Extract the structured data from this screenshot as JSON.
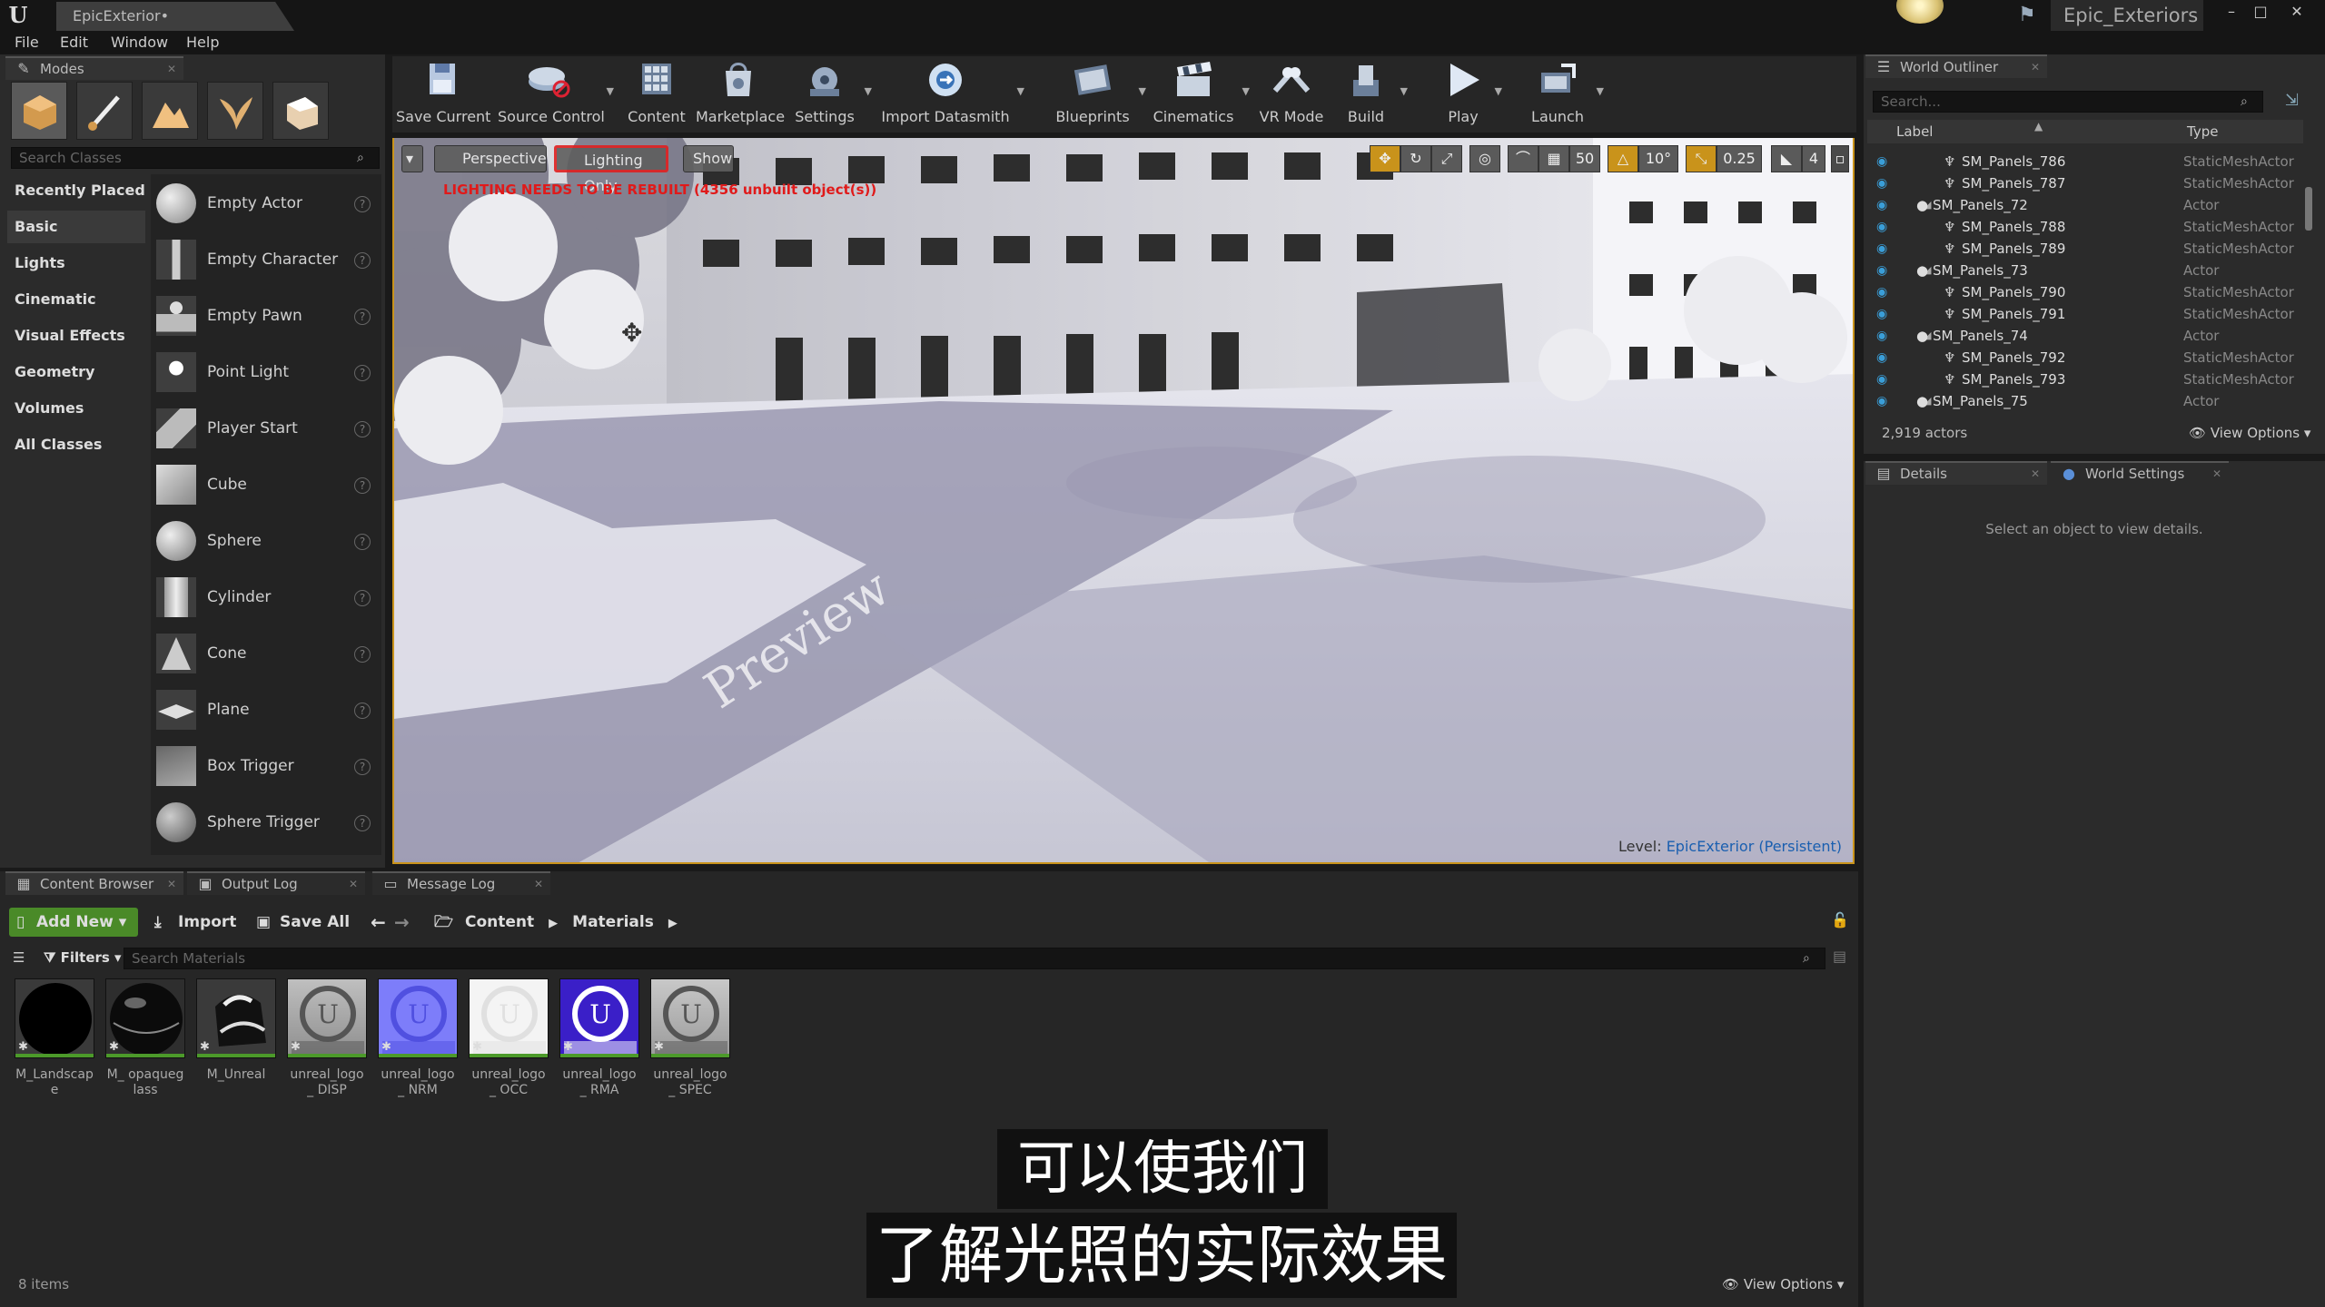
{
  "title_bar": {
    "doc_tab": "EpicExterior•",
    "project": "Epic_Exteriors",
    "buttons": [
      "–",
      "□",
      "✕"
    ]
  },
  "menu": [
    "File",
    "Edit",
    "Window",
    "Help"
  ],
  "modes": {
    "tab": "Modes",
    "search_placeholder": "Search Classes",
    "categories": [
      "Recently Placed",
      "Basic",
      "Lights",
      "Cinematic",
      "Visual Effects",
      "Geometry",
      "Volumes",
      "All Classes"
    ],
    "selected_category": "Basic",
    "classes": [
      "Empty Actor",
      "Empty Character",
      "Empty Pawn",
      "Point Light",
      "Player Start",
      "Cube",
      "Sphere",
      "Cylinder",
      "Cone",
      "Plane",
      "Box Trigger",
      "Sphere Trigger"
    ]
  },
  "toolbar": [
    {
      "label": "Save Current",
      "icon": "save-icon"
    },
    {
      "label": "Source Control",
      "icon": "source-control-icon"
    },
    {
      "label": "Content",
      "icon": "content-icon"
    },
    {
      "label": "Marketplace",
      "icon": "marketplace-icon"
    },
    {
      "label": "Settings",
      "icon": "settings-icon"
    },
    {
      "label": "Import Datasmith",
      "icon": "datasmith-icon"
    },
    {
      "label": "Blueprints",
      "icon": "blueprints-icon"
    },
    {
      "label": "Cinematics",
      "icon": "cinematics-icon"
    },
    {
      "label": "VR Mode",
      "icon": "vr-icon"
    },
    {
      "label": "Build",
      "icon": "build-icon"
    },
    {
      "label": "Play",
      "icon": "play-icon"
    },
    {
      "label": "Launch",
      "icon": "launch-icon"
    }
  ],
  "viewport": {
    "perspective": "Perspective",
    "view_mode": "Lighting Only",
    "show": "Show",
    "warning": "LIGHTING NEEDS TO BE REBUILT (4356 unbuilt object(s))",
    "level_label": "Level:",
    "level_name": "EpicExterior (Persistent)",
    "grid_snap": "50",
    "rotation_snap": "10°",
    "scale_snap": "0.25",
    "camera_speed": "4",
    "watermark": "Preview"
  },
  "outliner": {
    "tab": "World Outliner",
    "search_placeholder": "Search...",
    "col_label": "Label",
    "col_type": "Type",
    "rows": [
      {
        "name": "SM_Panels_786",
        "type": "StaticMeshActor",
        "indent": 2
      },
      {
        "name": "SM_Panels_787",
        "type": "StaticMeshActor",
        "indent": 2
      },
      {
        "name": "SM_Panels_72",
        "type": "Actor",
        "indent": 1
      },
      {
        "name": "SM_Panels_788",
        "type": "StaticMeshActor",
        "indent": 2
      },
      {
        "name": "SM_Panels_789",
        "type": "StaticMeshActor",
        "indent": 2
      },
      {
        "name": "SM_Panels_73",
        "type": "Actor",
        "indent": 1
      },
      {
        "name": "SM_Panels_790",
        "type": "StaticMeshActor",
        "indent": 2
      },
      {
        "name": "SM_Panels_791",
        "type": "StaticMeshActor",
        "indent": 2
      },
      {
        "name": "SM_Panels_74",
        "type": "Actor",
        "indent": 1
      },
      {
        "name": "SM_Panels_792",
        "type": "StaticMeshActor",
        "indent": 2
      },
      {
        "name": "SM_Panels_793",
        "type": "StaticMeshActor",
        "indent": 2
      },
      {
        "name": "SM_Panels_75",
        "type": "Actor",
        "indent": 1
      }
    ],
    "actor_count": "2,919 actors",
    "view_options": "View Options"
  },
  "details": {
    "tab": "Details",
    "world_settings_tab": "World Settings",
    "empty_message": "Select an object to view details."
  },
  "content_browser": {
    "tabs": [
      "Content Browser",
      "Output Log",
      "Message Log"
    ],
    "add_new": "Add New",
    "import": "Import",
    "save_all": "Save All",
    "path": [
      "Content",
      "Materials"
    ],
    "filters": "Filters",
    "search_placeholder": "Search Materials",
    "assets": [
      {
        "name": "M_Landscape",
        "style": "black"
      },
      {
        "name": "M_ opaqueglass",
        "style": "glass"
      },
      {
        "name": "M_Unreal",
        "style": "shoe"
      },
      {
        "name": "unreal_logo_ DISP",
        "style": "disp"
      },
      {
        "name": "unreal_logo_ NRM",
        "style": "nrm"
      },
      {
        "name": "unreal_logo_ OCC",
        "style": "occ"
      },
      {
        "name": "unreal_logo_ RMA",
        "style": "rma"
      },
      {
        "name": "unreal_logo_ SPEC",
        "style": "spec"
      }
    ],
    "item_count": "8 items",
    "view_options": "View Options"
  },
  "subtitles": [
    "可以使我们",
    "了解光照的实际效果"
  ]
}
